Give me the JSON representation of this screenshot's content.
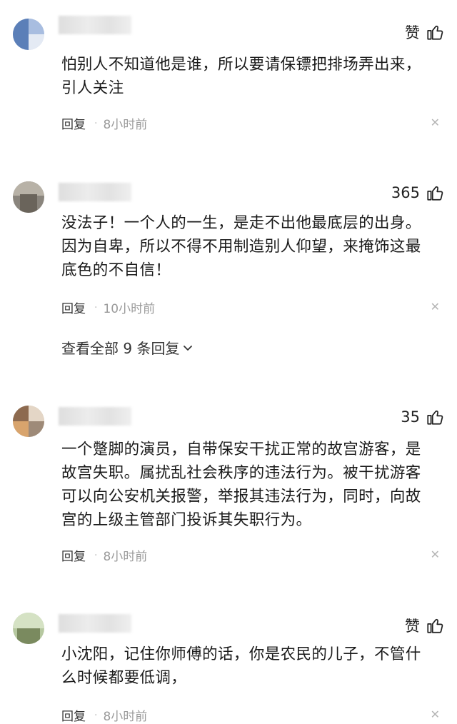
{
  "comments": [
    {
      "like": "赞",
      "text_lines": [
        "怕别人不知道他是谁，所以要请保镖把排场弄出来，",
        "引人关注"
      ],
      "reply": "回复",
      "time": "8小时前"
    },
    {
      "like": "365",
      "text_lines": [
        "没法子！一个人的一生，是走不出他最底层的出身。",
        "因为自卑，所以不得不用制造别人仰望，来掩饰这最",
        "底色的不自信！"
      ],
      "reply": "回复",
      "time": "10小时前",
      "view_all": "查看全部 9 条回复"
    },
    {
      "like": "35",
      "text_lines": [
        "一个蹩脚的演员，自带保安干扰正常的故宫游客，是",
        "故宫失职。属扰乱社会秩序的违法行为。被干扰游客",
        "可以向公安机关报警，举报其违法行为，同时，向故",
        "宫的上级主管部门投诉其失职行为。"
      ],
      "reply": "回复",
      "time": "8小时前"
    },
    {
      "like": "赞",
      "text_lines": [
        "小沈阳，记住你师傅的话，你是农民的儿子，不管什",
        "么时候都要低调，"
      ],
      "reply": "回复",
      "time": "8小时前"
    }
  ],
  "icons": {
    "like": "thumbs-up-icon",
    "close": "close-icon",
    "expand": "chevron-down-icon"
  },
  "colors": {
    "text": "#1a1a1a",
    "meta": "#9a9a9a",
    "close": "#b5b5b5"
  }
}
